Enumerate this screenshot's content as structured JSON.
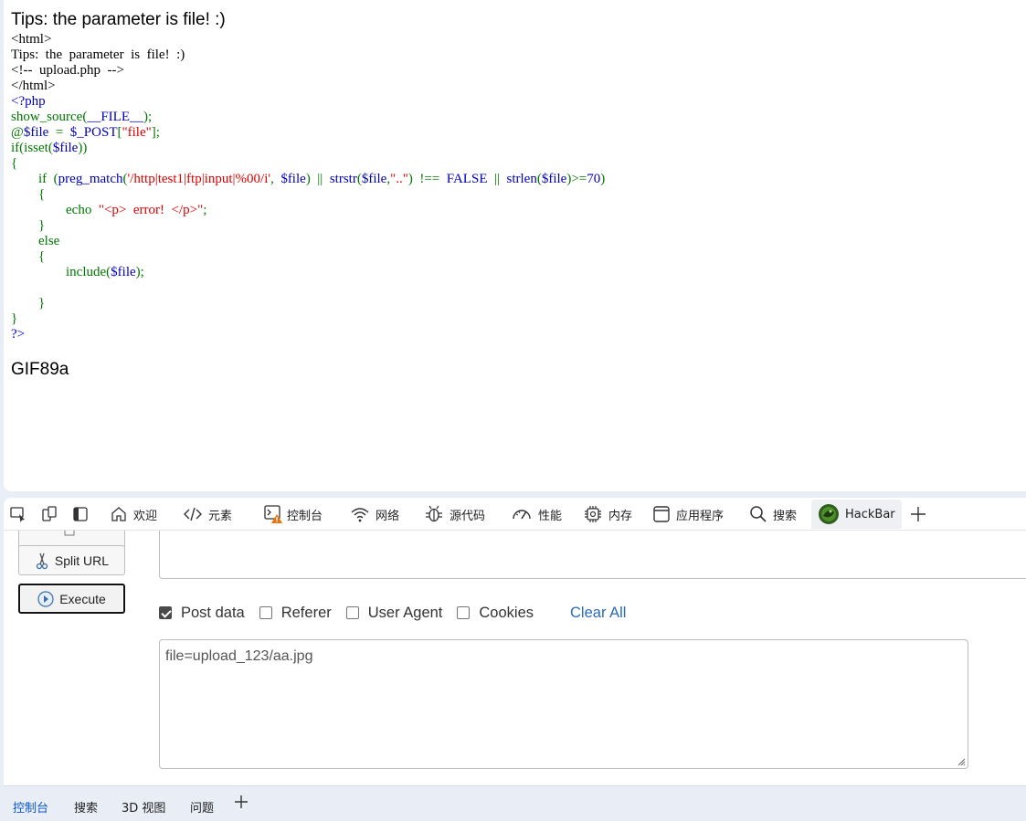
{
  "page": {
    "heading": "Tips: the parameter is file! :)",
    "source_lines": [
      [
        {
          "t": "<html>",
          "c": "html"
        }
      ],
      [
        {
          "t": "Tips:  the  parameter  is  file!  :)",
          "c": "html"
        }
      ],
      [
        {
          "t": "<!--  upload.php  -->",
          "c": "html"
        }
      ],
      [
        {
          "t": "</html>",
          "c": "html"
        }
      ],
      [
        {
          "t": "<?php",
          "c": "default"
        }
      ],
      [
        {
          "t": "show_source",
          "c": "keyword"
        },
        {
          "t": "(",
          "c": "keyword"
        },
        {
          "t": "__FILE__",
          "c": "default"
        },
        {
          "t": ");",
          "c": "keyword"
        }
      ],
      [
        {
          "t": "@",
          "c": "keyword"
        },
        {
          "t": "$file  ",
          "c": "default"
        },
        {
          "t": "=  ",
          "c": "keyword"
        },
        {
          "t": "$_POST",
          "c": "default"
        },
        {
          "t": "[",
          "c": "keyword"
        },
        {
          "t": "\"file\"",
          "c": "string"
        },
        {
          "t": "];",
          "c": "keyword"
        }
      ],
      [
        {
          "t": "if(isset(",
          "c": "keyword"
        },
        {
          "t": "$file",
          "c": "default"
        },
        {
          "t": "))",
          "c": "keyword"
        }
      ],
      [
        {
          "t": "{",
          "c": "keyword"
        }
      ],
      [
        {
          "t": "        if  (",
          "c": "keyword"
        },
        {
          "t": "preg_match",
          "c": "default"
        },
        {
          "t": "(",
          "c": "keyword"
        },
        {
          "t": "'/http|test1|ftp|input|%00/i'",
          "c": "string"
        },
        {
          "t": ",  ",
          "c": "keyword"
        },
        {
          "t": "$file",
          "c": "default"
        },
        {
          "t": ")  ||  ",
          "c": "keyword"
        },
        {
          "t": "strstr",
          "c": "default"
        },
        {
          "t": "(",
          "c": "keyword"
        },
        {
          "t": "$file",
          "c": "default"
        },
        {
          "t": ",",
          "c": "keyword"
        },
        {
          "t": "\"..\"",
          "c": "string"
        },
        {
          "t": ")  !==  ",
          "c": "keyword"
        },
        {
          "t": "FALSE  ",
          "c": "default"
        },
        {
          "t": "||  ",
          "c": "keyword"
        },
        {
          "t": "strlen",
          "c": "default"
        },
        {
          "t": "(",
          "c": "keyword"
        },
        {
          "t": "$file",
          "c": "default"
        },
        {
          "t": ")>=",
          "c": "keyword"
        },
        {
          "t": "70",
          "c": "default"
        },
        {
          "t": ")",
          "c": "keyword"
        }
      ],
      [
        {
          "t": "        {",
          "c": "keyword"
        }
      ],
      [
        {
          "t": "                echo  ",
          "c": "keyword"
        },
        {
          "t": "\"<p>  error!  </p>\"",
          "c": "string"
        },
        {
          "t": ";",
          "c": "keyword"
        }
      ],
      [
        {
          "t": "        }",
          "c": "keyword"
        }
      ],
      [
        {
          "t": "        else",
          "c": "keyword"
        }
      ],
      [
        {
          "t": "        {",
          "c": "keyword"
        }
      ],
      [
        {
          "t": "                include(",
          "c": "keyword"
        },
        {
          "t": "$file",
          "c": "default"
        },
        {
          "t": ");",
          "c": "keyword"
        }
      ],
      [
        {
          "t": "",
          "c": "keyword"
        }
      ],
      [
        {
          "t": "        }",
          "c": "keyword"
        }
      ],
      [
        {
          "t": "}",
          "c": "keyword"
        }
      ],
      [
        {
          "t": "?>",
          "c": "default"
        }
      ]
    ],
    "gif_text": "GIF89a"
  },
  "devtools": {
    "tabs": [
      {
        "id": "welcome",
        "label": "欢迎",
        "icon": "home-icon"
      },
      {
        "id": "elements",
        "label": "元素",
        "icon": "code-icon"
      },
      {
        "id": "console",
        "label": "控制台",
        "icon": "console-warning-icon"
      },
      {
        "id": "network",
        "label": "网络",
        "icon": "wifi-icon"
      },
      {
        "id": "sources",
        "label": "源代码",
        "icon": "bug-icon"
      },
      {
        "id": "performance",
        "label": "性能",
        "icon": "gauge-icon"
      },
      {
        "id": "memory",
        "label": "内存",
        "icon": "chip-icon"
      },
      {
        "id": "application",
        "label": "应用程序",
        "icon": "window-icon"
      },
      {
        "id": "search",
        "label": "搜索",
        "icon": "search-icon"
      },
      {
        "id": "hackbar",
        "label": "HackBar",
        "icon": "hackbar-logo-icon"
      }
    ],
    "active_tab": "HackBar",
    "drawer_tabs": [
      "控制台",
      "搜索",
      "3D 视图",
      "问题"
    ]
  },
  "hackbar": {
    "split_url_label": "Split URL",
    "execute_label": "Execute",
    "options": [
      {
        "label": "Post data",
        "checked": true
      },
      {
        "label": "Referer",
        "checked": false
      },
      {
        "label": "User Agent",
        "checked": false
      },
      {
        "label": "Cookies",
        "checked": false
      }
    ],
    "clear_all_label": "Clear All",
    "post_body": "file=upload_123/aa.jpg"
  },
  "colors": {
    "php_default": "#0000bb",
    "php_keyword": "#007700",
    "php_string": "#dd0000",
    "link_blue": "#2a6ab8",
    "active_drawer_tab": "#0b57d0"
  }
}
